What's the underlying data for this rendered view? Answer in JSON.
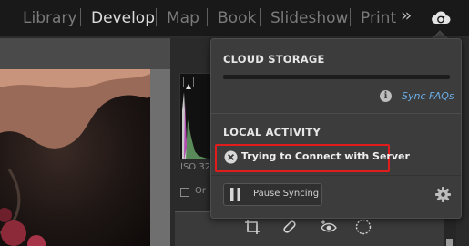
{
  "module_picker": {
    "items": [
      {
        "label": "Library",
        "active": false
      },
      {
        "label": "Develop",
        "active": true
      },
      {
        "label": "Map",
        "active": false
      },
      {
        "label": "Book",
        "active": false
      },
      {
        "label": "Slideshow",
        "active": false
      },
      {
        "label": "Print",
        "active": false
      }
    ],
    "overflow_icon": "double-chevron-right-icon",
    "cloud_icon": "cloud-sync-icon"
  },
  "right_panel": {
    "iso_text": "ISO 32",
    "original_label": "Or",
    "tools": [
      "crop-icon",
      "healing-brush-icon",
      "red-eye-icon",
      "radial-mask-icon"
    ]
  },
  "cloud_popup": {
    "storage_title": "CLOUD STORAGE",
    "faq_link": "Sync FAQs",
    "activity_title": "LOCAL ACTIVITY",
    "activity_status": "Trying to Connect with Server",
    "status_icon": "error-x-icon",
    "pause_label": "Pause Syncing",
    "settings_icon": "gear-icon"
  },
  "colors": {
    "highlight": "#e01c1c",
    "link": "#6aaee8",
    "popup_bg": "#3c3c3c"
  }
}
